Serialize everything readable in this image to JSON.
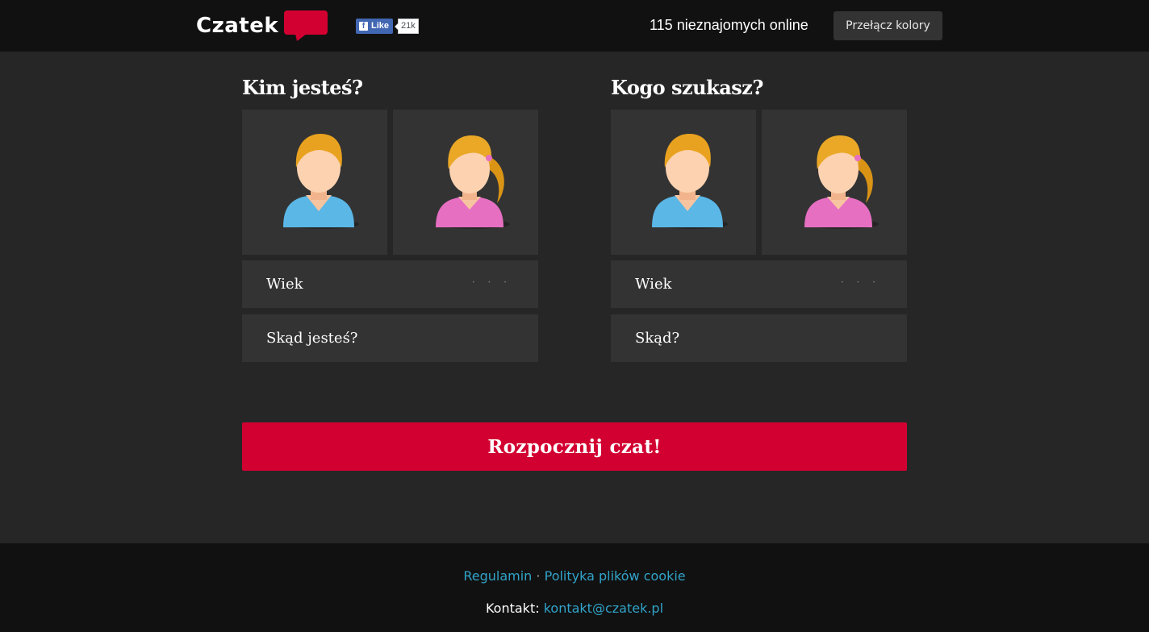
{
  "header": {
    "logo_text": "Czatek",
    "fb_like_label": "Like",
    "fb_like_count": "21k",
    "online_text": "115 nieznajomych online",
    "toggle_colors_label": "Przełącz kolory"
  },
  "left_column": {
    "title": "Kim jesteś?",
    "age_label": "Wiek",
    "age_dots": "· · ·",
    "location_label": "Skąd jesteś?"
  },
  "right_column": {
    "title": "Kogo szukasz?",
    "age_label": "Wiek",
    "age_dots": "· · ·",
    "location_label": "Skąd?"
  },
  "start_button_label": "Rozpocznij czat!",
  "footer": {
    "terms_link": "Regulamin",
    "separator": "·",
    "cookies_link": "Polityka plików cookie",
    "contact_label": "Kontakt:",
    "contact_email": "kontakt@czatek.pl"
  },
  "colors": {
    "accent_red": "#d20031",
    "link_blue": "#31a3c9",
    "background": "#262626",
    "bar_dark": "#111111",
    "tile": "#333333"
  }
}
